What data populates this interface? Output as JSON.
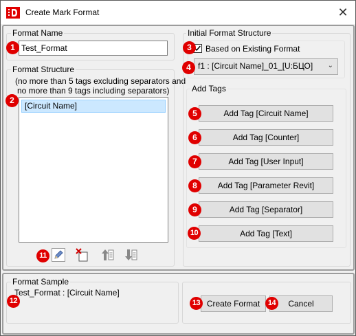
{
  "window": {
    "title": "Create Mark Format"
  },
  "format_name": {
    "label": "Format Name",
    "value": "Test_Format"
  },
  "format_structure": {
    "label": "Format Structure",
    "hint_line1": "(no more than 5 tags excluding separators and",
    "hint_line2": "no more than 9 tags including separators)",
    "items": [
      "[Circuit Name]"
    ]
  },
  "initial_structure": {
    "label": "Initial Format Structure",
    "checkbox_label": "Based on Existing Format",
    "checked": true,
    "selected_format": "f1 : [Circuit Name]_01_[U:БЦО]"
  },
  "add_tags": {
    "label": "Add Tags",
    "buttons": [
      "Add Tag [Circuit Name]",
      "Add Tag [Counter]",
      "Add Tag [User Input]",
      "Add Tag [Parameter Revit]",
      "Add Tag [Separator]",
      "Add Tag [Text]"
    ]
  },
  "format_sample": {
    "label": "Format Sample",
    "value": "Test_Format : [Circuit Name]"
  },
  "actions": {
    "create": "Create Format",
    "cancel": "Cancel"
  },
  "badges": [
    "1",
    "2",
    "3",
    "4",
    "5",
    "6",
    "7",
    "8",
    "9",
    "10",
    "11",
    "12",
    "13",
    "14"
  ],
  "colors": {
    "badge": "#e00000",
    "selection": "#cce8ff",
    "button": "#e1e1e1"
  }
}
